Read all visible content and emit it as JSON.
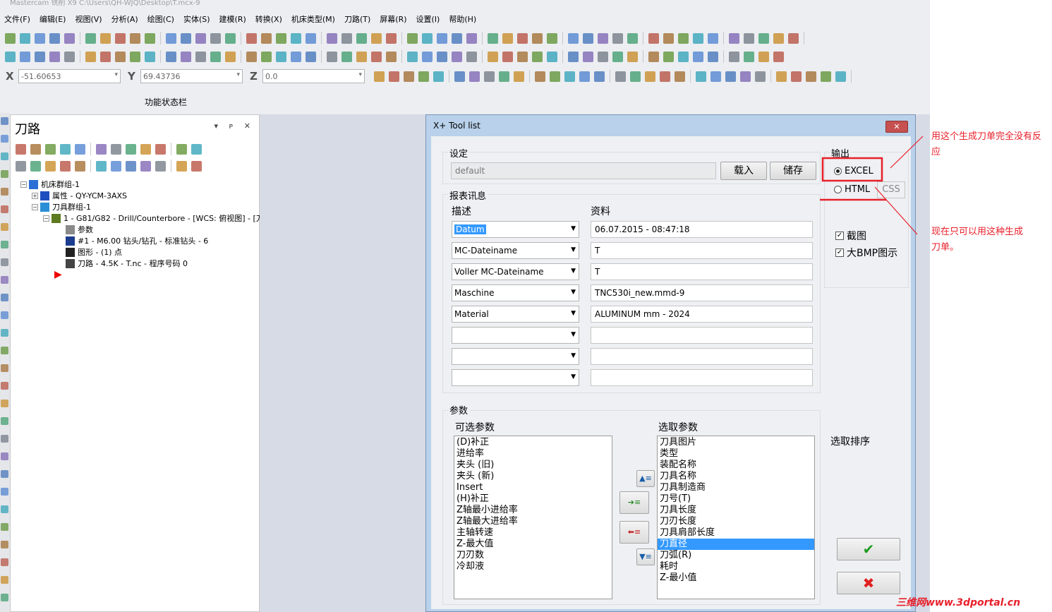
{
  "window_title": "Mastercam 铣削 X9  C:\\Users\\QH-WJQ\\Desktop\\T.mcx-9",
  "menu": [
    "文件(F)",
    "编辑(E)",
    "视图(V)",
    "分析(A)",
    "绘图(C)",
    "实体(S)",
    "建模(R)",
    "转换(X)",
    "机床类型(M)",
    "刀路(T)",
    "屏幕(R)",
    "设置(I)",
    "帮助(H)"
  ],
  "coords": {
    "x_label": "X",
    "x_value": "-51.60653",
    "y_label": "Y",
    "y_value": "69.43736",
    "z_label": "Z",
    "z_value": "0.0"
  },
  "status_bar_label": "功能状态栏",
  "panel": {
    "title": "刀路",
    "controls": "▾ ᴘ ✕",
    "tree": [
      {
        "label": "机床群组-1",
        "icon_color": "#2a6fd6"
      },
      {
        "label": "属性 - QY-YCM-3AXS",
        "icon_color": "#1f4fbf"
      },
      {
        "label": "刀具群组-1",
        "icon_color": "#2a8fd6"
      },
      {
        "label": "1 - G81/G82 - Drill/Counterbore - [WCS: 俯视图] - [刀...",
        "icon_color": "#5c7a1f"
      },
      {
        "label": "参数",
        "icon_color": "#8a8a8a"
      },
      {
        "label": "#1 - M6.00 钻头/钻孔 - 标准钻头 - 6",
        "icon_color": "#1c3d8f"
      },
      {
        "label": "图形 - (1) 点",
        "icon_color": "#222222"
      },
      {
        "label": "刀路 - 4.5K - T.nc - 程序号码 0",
        "icon_color": "#444444"
      }
    ]
  },
  "dialog": {
    "title": "X+ Tool list",
    "close": "✕",
    "settings": {
      "label": "设定",
      "value": "default",
      "load": "载入",
      "save": "储存"
    },
    "output": {
      "label": "输出",
      "excel": "EXCEL",
      "html": "HTML",
      "css": "CSS",
      "screenshot": "截图",
      "big_bmp": "大BMP图示"
    },
    "report": {
      "label": "报表讯息",
      "col_desc": "描述",
      "col_data": "资料",
      "rows": [
        {
          "desc": "Datum",
          "data": "06.07.2015 - 08:47:18"
        },
        {
          "desc": "MC-Dateiname",
          "data": "T"
        },
        {
          "desc": "Voller MC-Dateiname",
          "data": "T"
        },
        {
          "desc": "Maschine",
          "data": "TNC530i_new.mmd-9"
        },
        {
          "desc": "Material",
          "data": "ALUMINUM mm - 2024"
        },
        {
          "desc": "",
          "data": ""
        },
        {
          "desc": "",
          "data": ""
        },
        {
          "desc": "",
          "data": ""
        }
      ]
    },
    "params": {
      "label": "参数",
      "available_label": "可选参数",
      "selected_label": "选取参数",
      "sort_label": "选取排序",
      "available": [
        "(D)补正",
        "进给率",
        "夹头 (旧)",
        "夹头 (新)",
        "Insert",
        "(H)补正",
        "Z轴最小进给率",
        "Z轴最大进给率",
        "主轴转速",
        "Z-最大值",
        "刀刃数",
        "冷却液"
      ],
      "selected": [
        "刀具图片",
        "类型",
        "装配名称",
        "刀具名称",
        "刀具制造商",
        "刀号(T)",
        "刀具长度",
        "刀刃长度",
        "刀具肩部长度",
        "刀直径",
        "刀弧(R)",
        "耗时",
        "Z-最小值"
      ],
      "selected_highlight_index": 9,
      "ok": "✔",
      "cancel": "✖"
    }
  },
  "annotations": {
    "top": "用这个生成刀单完全没有反应",
    "bottom": "现在只可以用这种生成刀单。",
    "color": "#e8202a"
  },
  "watermark": "三维网www.3dportal.cn"
}
